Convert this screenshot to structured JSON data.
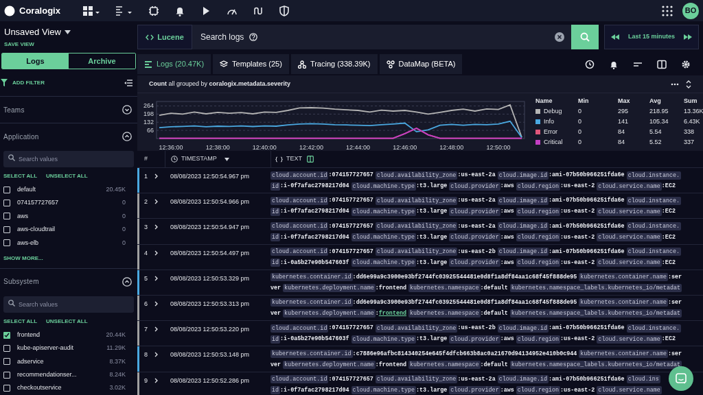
{
  "topbar": {
    "brand": "Coralogix",
    "avatar": "BO"
  },
  "view": {
    "title": "Unsaved View",
    "save": "SAVE VIEW"
  },
  "search": {
    "syntax": "Lucene",
    "placeholder": "Search logs",
    "time_range": "Last 15 minutes"
  },
  "sidebar": {
    "mode_tabs": [
      {
        "label": "Logs",
        "selected": true
      },
      {
        "label": "Archive",
        "selected": false
      }
    ],
    "add_filter": "ADD FILTER",
    "filters": [
      {
        "title": "Teams",
        "expanded": false
      },
      {
        "title": "Application",
        "expanded": true,
        "placeholder": "Search values",
        "select_all": "SELECT ALL",
        "unselect_all": "UNSELECT ALL",
        "show_more": "SHOW MORE...",
        "items": [
          {
            "label": "default",
            "count": "20.45K",
            "checked": false
          },
          {
            "label": "074157727657",
            "count": "0",
            "checked": false
          },
          {
            "label": "aws",
            "count": "0",
            "checked": false
          },
          {
            "label": "aws-cloudtrail",
            "count": "0",
            "checked": false
          },
          {
            "label": "aws-elb",
            "count": "0",
            "checked": false
          }
        ]
      },
      {
        "title": "Subsystem",
        "expanded": true,
        "placeholder": "Search values",
        "select_all": "SELECT ALL",
        "unselect_all": "UNSELECT ALL",
        "items": [
          {
            "label": "frontend",
            "count": "20.44K",
            "checked": true
          },
          {
            "label": "kube-apiserver-audit",
            "count": "11.29K",
            "checked": false
          },
          {
            "label": "adservice",
            "count": "8.37K",
            "checked": false
          },
          {
            "label": "recommendationser...",
            "count": "8.24K",
            "checked": false
          },
          {
            "label": "checkoutservice",
            "count": "3.02K",
            "checked": false
          }
        ]
      }
    ]
  },
  "tabs": [
    {
      "label": "Logs (20.47K)",
      "selected": true
    },
    {
      "label": "Templates (25)",
      "selected": false
    },
    {
      "label": "Tracing (338.39K)",
      "selected": false
    },
    {
      "label": "DataMap (BETA)",
      "selected": false
    }
  ],
  "chart": {
    "title": "**Count** all grouped by **coralogix.metadata.severity**",
    "chart_data": {
      "type": "line",
      "categories": [
        null,
        "12:36:00",
        null,
        null,
        null,
        "12:38:00",
        null,
        null,
        null,
        "12:40:00",
        null,
        null,
        null,
        "12:42:00",
        null,
        null,
        null,
        "12:44:00",
        null,
        null,
        null,
        "12:46:00",
        null,
        null,
        null,
        "12:48:00",
        null,
        null,
        null,
        "12:50:00",
        null,
        null
      ],
      "grid": true,
      "ylim": [
        0,
        300
      ],
      "yticks": [
        66,
        132,
        198,
        264
      ],
      "series": [
        {
          "name": "Debug",
          "color": "#b4b4b4",
          "values": [
            188,
            205,
            198,
            215,
            200,
            212,
            205,
            210,
            200,
            215,
            212,
            228,
            248,
            250,
            246,
            238,
            232,
            228,
            215,
            230,
            222,
            228,
            215,
            198,
            212,
            228,
            238,
            222,
            240,
            235,
            272,
            10
          ]
        },
        {
          "name": "Info",
          "color": "#4aa8e0",
          "values": [
            88,
            95,
            98,
            102,
            95,
            100,
            98,
            102,
            97,
            102,
            100,
            110,
            118,
            120,
            118,
            112,
            110,
            108,
            105,
            112,
            118,
            125,
            55,
            70,
            108,
            115,
            108,
            115,
            112,
            118,
            140,
            8
          ]
        },
        {
          "name": "Error",
          "color": "#e0567a",
          "values": [
            2,
            2,
            2,
            2,
            2,
            2,
            2,
            2,
            2,
            2,
            2,
            2,
            2,
            2,
            2,
            2,
            2,
            2,
            2,
            2,
            2,
            40,
            84,
            30,
            2,
            2,
            2,
            2,
            2,
            2,
            2,
            2
          ]
        },
        {
          "name": "Critical",
          "color": "#c43fc4",
          "values": [
            2,
            2,
            2,
            2,
            2,
            2,
            2,
            2,
            2,
            2,
            2,
            2,
            2,
            2,
            2,
            2,
            2,
            2,
            2,
            2,
            2,
            40,
            84,
            30,
            2,
            2,
            2,
            2,
            2,
            2,
            2,
            2
          ]
        }
      ]
    },
    "legend": {
      "columns": [
        "Name",
        "Min",
        "Max",
        "Avg",
        "Sum"
      ],
      "rows": [
        {
          "min": "0",
          "max": "295",
          "avg": "218.95",
          "sum": "13.36K"
        },
        {
          "min": "0",
          "max": "141",
          "avg": "105.34",
          "sum": "6.43K"
        },
        {
          "min": "0",
          "max": "84",
          "avg": "5.54",
          "sum": "338"
        },
        {
          "min": "0",
          "max": "84",
          "avg": "5.52",
          "sum": "337"
        }
      ]
    }
  },
  "table": {
    "columns": [
      "#",
      "TIMESTAMP",
      "TEXT"
    ],
    "rows": [
      {
        "number": "1",
        "timestamp": "08/08/2023 12:50:54.967 pm",
        "color": "#4aa8e0",
        "lines": [
          [
            {
              "kind": "key",
              "text": "cloud.account.id"
            },
            {
              "kind": "value",
              "text": ":074157727657"
            },
            {
              "kind": "key",
              "text": "cloud.availability_zone"
            },
            {
              "kind": "value",
              "text": ":us-east-2a"
            },
            {
              "kind": "key",
              "text": "cloud.image.id"
            },
            {
              "kind": "value",
              "text": ":ami-07b50b966251fda6e"
            },
            {
              "kind": "key",
              "text": "cloud.instance."
            }
          ],
          [
            {
              "kind": "key",
              "text": "id"
            },
            {
              "kind": "value",
              "text": ":i-0f7afac2798217d04"
            },
            {
              "kind": "key",
              "text": "cloud.machine.type"
            },
            {
              "kind": "value",
              "text": ":t3.large"
            },
            {
              "kind": "key",
              "text": "cloud.provider"
            },
            {
              "kind": "value",
              "text": ":aws"
            },
            {
              "kind": "key",
              "text": "cloud.region"
            },
            {
              "kind": "value",
              "text": ":us-east-2"
            },
            {
              "kind": "key",
              "text": "cloud.service.name"
            },
            {
              "kind": "value",
              "text": ":EC2"
            }
          ]
        ]
      },
      {
        "number": "2",
        "timestamp": "08/08/2023 12:50:54.966 pm",
        "color": "#a0a0a0",
        "lines": [
          [
            {
              "kind": "key",
              "text": "cloud.account.id"
            },
            {
              "kind": "value",
              "text": ":074157727657"
            },
            {
              "kind": "key",
              "text": "cloud.availability_zone"
            },
            {
              "kind": "value",
              "text": ":us-east-2a"
            },
            {
              "kind": "key",
              "text": "cloud.image.id"
            },
            {
              "kind": "value",
              "text": ":ami-07b50b966251fda6e"
            },
            {
              "kind": "key",
              "text": "cloud.instance."
            }
          ],
          [
            {
              "kind": "key",
              "text": "id"
            },
            {
              "kind": "value",
              "text": ":i-0f7afac2798217d04"
            },
            {
              "kind": "key",
              "text": "cloud.machine.type"
            },
            {
              "kind": "value",
              "text": ":t3.large"
            },
            {
              "kind": "key",
              "text": "cloud.provider"
            },
            {
              "kind": "value",
              "text": ":aws"
            },
            {
              "kind": "key",
              "text": "cloud.region"
            },
            {
              "kind": "value",
              "text": ":us-east-2"
            },
            {
              "kind": "key",
              "text": "cloud.service.name"
            },
            {
              "kind": "value",
              "text": ":EC2"
            }
          ]
        ]
      },
      {
        "number": "3",
        "timestamp": "08/08/2023 12:50:54.947 pm",
        "color": "#a0a0a0",
        "lines": [
          [
            {
              "kind": "key",
              "text": "cloud.account.id"
            },
            {
              "kind": "value",
              "text": ":074157727657"
            },
            {
              "kind": "key",
              "text": "cloud.availability_zone"
            },
            {
              "kind": "value",
              "text": ":us-east-2a"
            },
            {
              "kind": "key",
              "text": "cloud.image.id"
            },
            {
              "kind": "value",
              "text": ":ami-07b50b966251fda6e"
            },
            {
              "kind": "key",
              "text": "cloud.instance."
            }
          ],
          [
            {
              "kind": "key",
              "text": "id"
            },
            {
              "kind": "value",
              "text": ":i-0f7afac2798217d04"
            },
            {
              "kind": "key",
              "text": "cloud.machine.type"
            },
            {
              "kind": "value",
              "text": ":t3.large"
            },
            {
              "kind": "key",
              "text": "cloud.provider"
            },
            {
              "kind": "value",
              "text": ":aws"
            },
            {
              "kind": "key",
              "text": "cloud.region"
            },
            {
              "kind": "value",
              "text": ":us-east-2"
            },
            {
              "kind": "key",
              "text": "cloud.service.name"
            },
            {
              "kind": "value",
              "text": ":EC2"
            }
          ]
        ]
      },
      {
        "number": "4",
        "timestamp": "08/08/2023 12:50:54.497 pm",
        "color": "#a0a0a0",
        "lines": [
          [
            {
              "kind": "key",
              "text": "cloud.account.id"
            },
            {
              "kind": "value",
              "text": ":074157727657"
            },
            {
              "kind": "key",
              "text": "cloud.availability_zone"
            },
            {
              "kind": "value",
              "text": ":us-east-2b"
            },
            {
              "kind": "key",
              "text": "cloud.image.id"
            },
            {
              "kind": "value",
              "text": ":ami-07b50b966251fda6e"
            },
            {
              "kind": "key",
              "text": "cloud.instance."
            }
          ],
          [
            {
              "kind": "key",
              "text": "id"
            },
            {
              "kind": "value",
              "text": ":i-0a5b27e90b547603f"
            },
            {
              "kind": "key",
              "text": "cloud.machine.type"
            },
            {
              "kind": "value",
              "text": ":t3.large"
            },
            {
              "kind": "key",
              "text": "cloud.provider"
            },
            {
              "kind": "value",
              "text": ":aws"
            },
            {
              "kind": "key",
              "text": "cloud.region"
            },
            {
              "kind": "value",
              "text": ":us-east-2"
            },
            {
              "kind": "key",
              "text": "cloud.service.name"
            },
            {
              "kind": "value",
              "text": ":EC2"
            }
          ]
        ]
      },
      {
        "number": "5",
        "timestamp": "08/08/2023 12:50:53.329 pm",
        "color": "#4aa8e0",
        "lines": [
          [
            {
              "kind": "key",
              "text": "kubernetes.container.id"
            },
            {
              "kind": "value",
              "text": ":dd6e99a9c3900e93bf2744fc03925544481e0d8f1a8df84aa1c68f45f888de95"
            },
            {
              "kind": "key",
              "text": "kubernetes.container.name"
            },
            {
              "kind": "value",
              "text": ":ser"
            }
          ],
          [
            {
              "kind": "value",
              "text": "ver"
            },
            {
              "kind": "key",
              "text": "kubernetes.deployment.name"
            },
            {
              "kind": "value",
              "text": ":frontend"
            },
            {
              "kind": "key",
              "text": "kubernetes.namespace"
            },
            {
              "kind": "value",
              "text": ":default"
            },
            {
              "kind": "key",
              "text": "kubernetes.namespace_labels.kubernetes_io/metadat"
            }
          ]
        ]
      },
      {
        "number": "6",
        "timestamp": "08/08/2023 12:50:53.313 pm",
        "color": "#a0a0a0",
        "lines": [
          [
            {
              "kind": "key",
              "text": "kubernetes.container.id"
            },
            {
              "kind": "value",
              "text": ":dd6e99a9c3900e93bf2744fc03925544481e0d8f1a8df84aa1c68f45f888de95"
            },
            {
              "kind": "key",
              "text": "kubernetes.container.name"
            },
            {
              "kind": "value",
              "text": ":ser"
            }
          ],
          [
            {
              "kind": "value",
              "text": "ver"
            },
            {
              "kind": "key",
              "text": "kubernetes.deployment.name"
            },
            {
              "kind": "value",
              "text": ":"
            },
            {
              "kind": "link",
              "text": "frontend"
            },
            {
              "kind": "key",
              "text": "kubernetes.namespace"
            },
            {
              "kind": "value",
              "text": ":default"
            },
            {
              "kind": "key",
              "text": "kubernetes.namespace_labels.kubernetes_io/metadat"
            }
          ]
        ]
      },
      {
        "number": "7",
        "timestamp": "08/08/2023 12:50:53.220 pm",
        "color": "#a0a0a0",
        "lines": [
          [
            {
              "kind": "key",
              "text": "cloud.account.id"
            },
            {
              "kind": "value",
              "text": ":074157727657"
            },
            {
              "kind": "key",
              "text": "cloud.availability_zone"
            },
            {
              "kind": "value",
              "text": ":us-east-2b"
            },
            {
              "kind": "key",
              "text": "cloud.image.id"
            },
            {
              "kind": "value",
              "text": ":ami-07b50b966251fda6e"
            },
            {
              "kind": "key",
              "text": "cloud.instance."
            }
          ],
          [
            {
              "kind": "key",
              "text": "id"
            },
            {
              "kind": "value",
              "text": ":i-0a5b27e90b547603f"
            },
            {
              "kind": "key",
              "text": "cloud.machine.type"
            },
            {
              "kind": "value",
              "text": ":t3.large"
            },
            {
              "kind": "key",
              "text": "cloud.provider"
            },
            {
              "kind": "value",
              "text": ":aws"
            },
            {
              "kind": "key",
              "text": "cloud.region"
            },
            {
              "kind": "value",
              "text": ":us-east-2"
            },
            {
              "kind": "key",
              "text": "cloud.service.name"
            },
            {
              "kind": "value",
              "text": ":EC2"
            }
          ]
        ]
      },
      {
        "number": "8",
        "timestamp": "08/08/2023 12:50:53.148 pm",
        "color": "#4aa8e0",
        "lines": [
          [
            {
              "kind": "key",
              "text": "kubernetes.container.id"
            },
            {
              "kind": "value",
              "text": ":c7886e96afbc814340254e645f4dfcb663b8ac0a21670d94134952e410b0c944"
            },
            {
              "kind": "key",
              "text": "kubernetes.container.name"
            },
            {
              "kind": "value",
              "text": ":ser"
            }
          ],
          [
            {
              "kind": "value",
              "text": "ver"
            },
            {
              "kind": "key",
              "text": "kubernetes.deployment.name"
            },
            {
              "kind": "value",
              "text": ":frontend"
            },
            {
              "kind": "key",
              "text": "kubernetes.namespace"
            },
            {
              "kind": "value",
              "text": ":default"
            },
            {
              "kind": "key",
              "text": "kubernetes.namespace_labels.kubernetes_io/metadat"
            }
          ]
        ]
      },
      {
        "number": "9",
        "timestamp": "08/08/2023 12:50:52.286 pm",
        "color": "#a0a0a0",
        "lines": [
          [
            {
              "kind": "key",
              "text": "cloud.account.id"
            },
            {
              "kind": "value",
              "text": ":074157727657"
            },
            {
              "kind": "key",
              "text": "cloud.availability_zone"
            },
            {
              "kind": "value",
              "text": ":us-east-2a"
            },
            {
              "kind": "key",
              "text": "cloud.image.id"
            },
            {
              "kind": "value",
              "text": ":ami-07b50b966251fda6e"
            },
            {
              "kind": "key",
              "text": "cloud.ins"
            }
          ],
          [
            {
              "kind": "key",
              "text": "id"
            },
            {
              "kind": "value",
              "text": ":i-0f7afac2798217d04"
            },
            {
              "kind": "key",
              "text": "cloud.machine.type"
            },
            {
              "kind": "value",
              "text": ":t3.large"
            },
            {
              "kind": "key",
              "text": "cloud.provider"
            },
            {
              "kind": "value",
              "text": ":aws"
            },
            {
              "kind": "key",
              "text": "cloud.region"
            },
            {
              "kind": "value",
              "text": ":us-east-2"
            },
            {
              "kind": "key",
              "text": "cloud.service.name"
            }
          ]
        ]
      }
    ]
  }
}
